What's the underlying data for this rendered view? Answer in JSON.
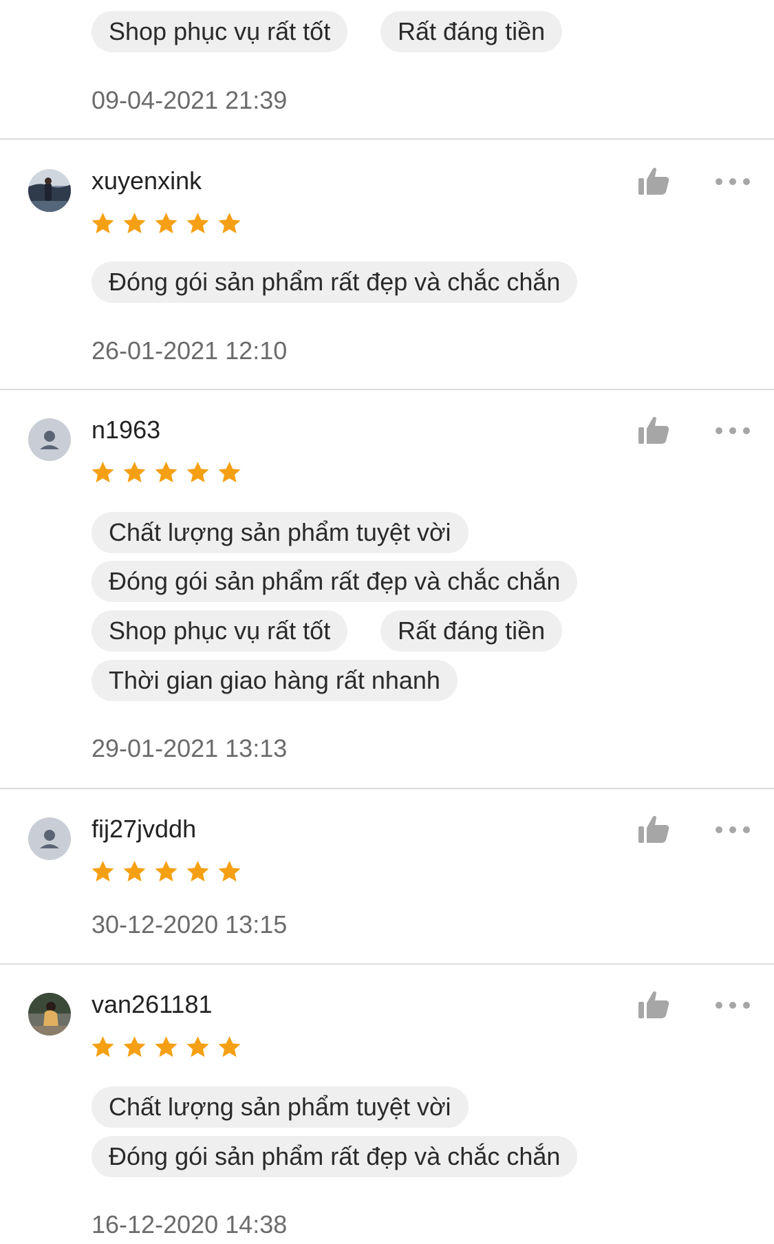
{
  "reviews": [
    {
      "tags": [
        "Shop phục vụ rất tốt",
        "Rất đáng tiền"
      ],
      "date": "09-04-2021 21:39"
    },
    {
      "username": "xuyenxink",
      "avatar": "photo-avatar",
      "rating": 5,
      "tags": [
        "Đóng gói sản phẩm rất đẹp và chắc chắn"
      ],
      "date": "26-01-2021 12:10"
    },
    {
      "username": "n1963",
      "avatar": "default-user-avatar",
      "rating": 5,
      "tags": [
        "Chất lượng sản phẩm tuyệt vời",
        "Đóng gói sản phẩm rất đẹp và chắc chắn",
        "Shop phục vụ rất tốt",
        "Rất đáng tiền",
        "Thời gian giao hàng rất nhanh"
      ],
      "date": "29-01-2021 13:13"
    },
    {
      "username": "fij27jvddh",
      "avatar": "default-user-avatar",
      "rating": 5,
      "tags": [],
      "date": "30-12-2020 13:15"
    },
    {
      "username": "van261181",
      "avatar": "photo-avatar",
      "rating": 5,
      "tags": [
        "Chất lượng sản phẩm tuyệt vời",
        "Đóng gói sản phẩm rất đẹp và chắc chắn"
      ],
      "date": "16-12-2020 14:38"
    }
  ],
  "icons": {
    "like": "thumbs-up-icon",
    "more": "more-options-icon",
    "star": "star-icon"
  },
  "colors": {
    "star": "#f5a014",
    "tag_background": "#efefef",
    "date_text": "#6b6b6b",
    "icon_gray": "#a6a6a6"
  }
}
